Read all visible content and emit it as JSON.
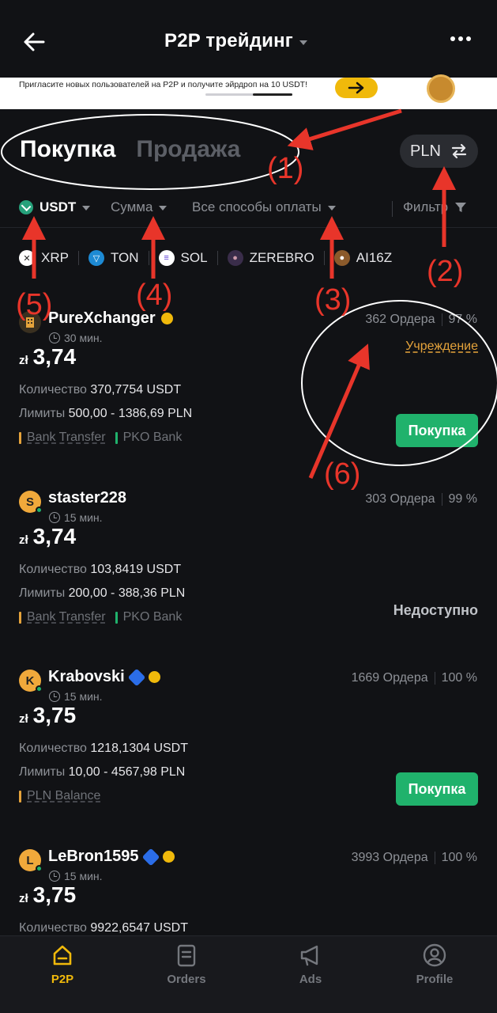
{
  "header": {
    "title": "P2P трейдинг"
  },
  "banner": {
    "text": "Пригласите новых пользователей на P2P и получите эйрдроп на 10 USDT!"
  },
  "trade_tabs": {
    "buy": "Покупка",
    "sell": "Продажа"
  },
  "fiat": {
    "code": "PLN"
  },
  "filters": {
    "asset": "USDT",
    "amount": "Сумма",
    "payment": "Все способы оплаты",
    "filter": "Фильтр"
  },
  "coins": [
    "XRP",
    "TON",
    "SOL",
    "ZEREBRO",
    "AI16Z"
  ],
  "offers": [
    {
      "name": "PureXchanger",
      "time": "30 мин.",
      "orders": "362 Ордера",
      "rate": "97 %",
      "institution": "Учреждение",
      "currency": "zł",
      "price": "3,74",
      "qty_label": "Количество",
      "qty": "370,7754 USDT",
      "lim_label": "Лимиты",
      "limits": "500,00 - 1386,69 PLN",
      "pay1": "Bank Transfer",
      "pay2": "PKO Bank",
      "action": "Покупка"
    },
    {
      "name": "staster228",
      "initial": "S",
      "time": "15 мин.",
      "orders": "303 Ордера",
      "rate": "99 %",
      "currency": "zł",
      "price": "3,74",
      "qty_label": "Количество",
      "qty": "103,8419 USDT",
      "lim_label": "Лимиты",
      "limits": "200,00 - 388,36 PLN",
      "pay1": "Bank Transfer",
      "pay2": "PKO Bank",
      "status": "Недоступно"
    },
    {
      "name": "Krabovski",
      "initial": "K",
      "time": "15 мин.",
      "orders": "1669 Ордера",
      "rate": "100 %",
      "currency": "zł",
      "price": "3,75",
      "qty_label": "Количество",
      "qty": "1218,1304 USDT",
      "lim_label": "Лимиты",
      "limits": "10,00 - 4567,98 PLN",
      "pay1": "PLN Balance",
      "action": "Покупка"
    },
    {
      "name": "LeBron1595",
      "initial": "L",
      "time": "15 мин.",
      "orders": "3993 Ордера",
      "rate": "100 %",
      "currency": "zł",
      "price": "3,75",
      "qty_label": "Количество",
      "qty": "9922,6547 USDT"
    }
  ],
  "nav": {
    "p2p": "P2P",
    "orders": "Orders",
    "ads": "Ads",
    "profile": "Profile"
  },
  "annotations": [
    "(1)",
    "(2)",
    "(3)",
    "(4)",
    "(5)",
    "(6)"
  ],
  "colors": {
    "accent": "#f0b90b",
    "buy": "#20b26c",
    "annotation": "#e8352a",
    "bg": "#111215"
  }
}
